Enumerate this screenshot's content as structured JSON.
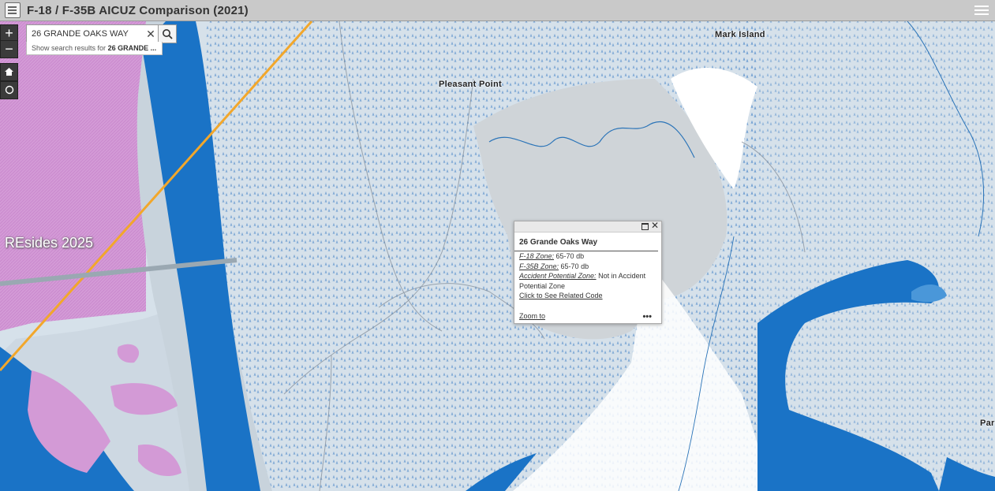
{
  "app": {
    "title": "F-18 / F-35B AICUZ Comparison (2021)"
  },
  "controls": {
    "zoom_in": "+",
    "zoom_out": "−"
  },
  "search": {
    "value": "26 GRANDE OAKS WAY",
    "suggest_prefix": "Show search results for",
    "suggest_term": "26 GRANDE ..."
  },
  "map": {
    "labels": {
      "mark_island": "Mark Island",
      "pleasant_point": "Pleasant Point",
      "partial_right": "Par"
    },
    "watermark": "REsides 2025",
    "colors": {
      "water": "#1a73c6",
      "pink": "#d9a8d8",
      "gray": "#d3d3d3",
      "light_blue": "#d4e2ec",
      "orange": "#f2a72b"
    }
  },
  "popup": {
    "title": "26 Grande Oaks Way",
    "f18_label": "F-18 Zone:",
    "f18_value": "65-70 db",
    "f35_label": "F-35B Zone:",
    "f35_value": "65-70 db",
    "apz_label": "Accident Potential Zone:",
    "apz_value": "Not in Accident Potential Zone",
    "link": "Click to See Related Code",
    "zoom_to": "Zoom to",
    "more": "•••"
  }
}
